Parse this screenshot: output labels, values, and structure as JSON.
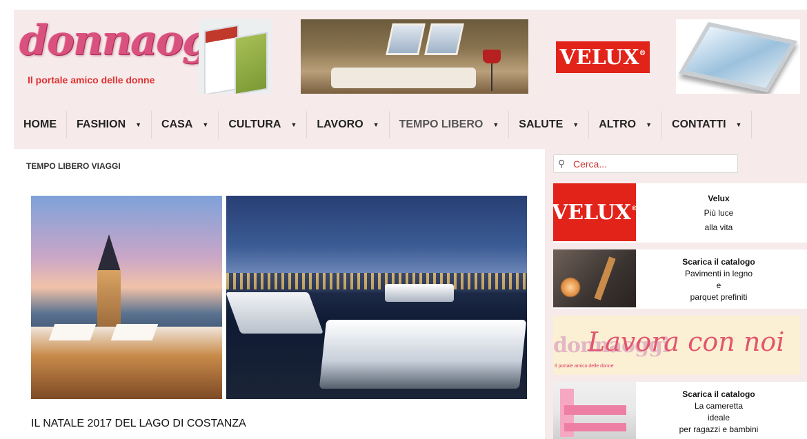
{
  "header": {
    "logo_word": "donnaoggi",
    "logo_tagline": "Il portale amico delle donne",
    "banner_brand": "VELUX",
    "banner_brand_mark": "®"
  },
  "nav": {
    "items": [
      {
        "label": "HOME",
        "has_dropdown": false
      },
      {
        "label": "FASHION",
        "has_dropdown": true
      },
      {
        "label": "CASA",
        "has_dropdown": true
      },
      {
        "label": "CULTURA",
        "has_dropdown": true
      },
      {
        "label": "LAVORO",
        "has_dropdown": true
      },
      {
        "label": "TEMPO LIBERO",
        "has_dropdown": true
      },
      {
        "label": "SALUTE",
        "has_dropdown": true
      },
      {
        "label": "ALTRO",
        "has_dropdown": true
      },
      {
        "label": "CONTATTI",
        "has_dropdown": true
      }
    ],
    "active": "TEMPO LIBERO",
    "dropdown_glyph": "▼"
  },
  "main": {
    "breadcrumb": "TEMPO LIBERO VIAGGI",
    "article_title": "IL NATALE 2017 DEL LAGO DI COSTANZA"
  },
  "sidebar": {
    "search_placeholder": "Cerca...",
    "ads": [
      {
        "image": "velux-logo",
        "image_label": "VELUX",
        "title": "Velux",
        "lines": [
          "Più luce",
          "alla vita"
        ]
      },
      {
        "image": "parquet-room",
        "title": "Scarica il catalogo",
        "lines": [
          "Pavimenti in legno",
          "e",
          "parquet prefiniti"
        ]
      },
      {
        "image": "kids-room",
        "title": "Scarica il catalogo",
        "lines": [
          "La cameretta",
          "ideale",
          "per ragazzi e bambini"
        ]
      }
    ],
    "lavora_banner": {
      "logo_word": "donnaoggi",
      "logo_tagline": "Il portale amico delle donne",
      "text": "Lavora con noi"
    }
  },
  "colors": {
    "page_background": "#f6eaea",
    "brand_red": "#e2231a",
    "logo_pink": "#d9517f",
    "lavora_text": "#e2566e",
    "search_text": "#cc3333"
  }
}
